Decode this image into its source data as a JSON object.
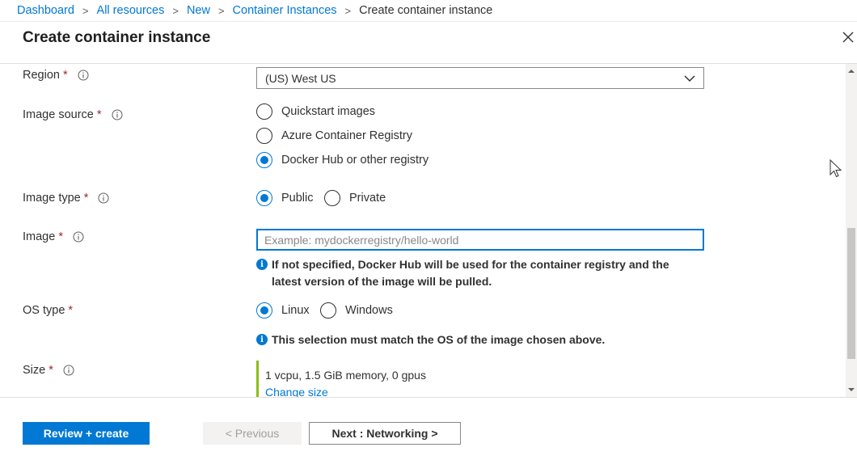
{
  "breadcrumb": {
    "items": [
      "Dashboard",
      "All resources",
      "New",
      "Container Instances"
    ],
    "current": "Create container instance",
    "separator": ">"
  },
  "blade": {
    "title": "Create container instance"
  },
  "form": {
    "required_mark": "*",
    "region": {
      "label": "Region",
      "value": "(US) West US"
    },
    "image_source": {
      "label": "Image source",
      "options": [
        {
          "label": "Quickstart images",
          "checked": false
        },
        {
          "label": "Azure Container Registry",
          "checked": false
        },
        {
          "label": "Docker Hub or other registry",
          "checked": true
        }
      ]
    },
    "image_type": {
      "label": "Image type",
      "options": [
        {
          "label": "Public",
          "checked": true
        },
        {
          "label": "Private",
          "checked": false
        }
      ]
    },
    "image": {
      "label": "Image",
      "value": "",
      "placeholder": "Example: mydockerregistry/hello-world",
      "info_line1": "If not specified, Docker Hub will be used for the container registry and the",
      "info_line2": "latest version of the image will be pulled."
    },
    "os_type": {
      "label": "OS type",
      "options": [
        {
          "label": "Linux",
          "checked": true
        },
        {
          "label": "Windows",
          "checked": false
        }
      ],
      "info": "This selection must match the OS of the image chosen above."
    },
    "size": {
      "label": "Size",
      "value": "1 vcpu, 1.5 GiB memory, 0 gpus",
      "change_link": "Change size"
    }
  },
  "footer": {
    "review_create": "Review + create",
    "previous": "< Previous",
    "next": "Next : Networking >"
  },
  "colors": {
    "accent": "#0078d4",
    "required": "#a4262c",
    "size_bar": "#8cbd18"
  }
}
